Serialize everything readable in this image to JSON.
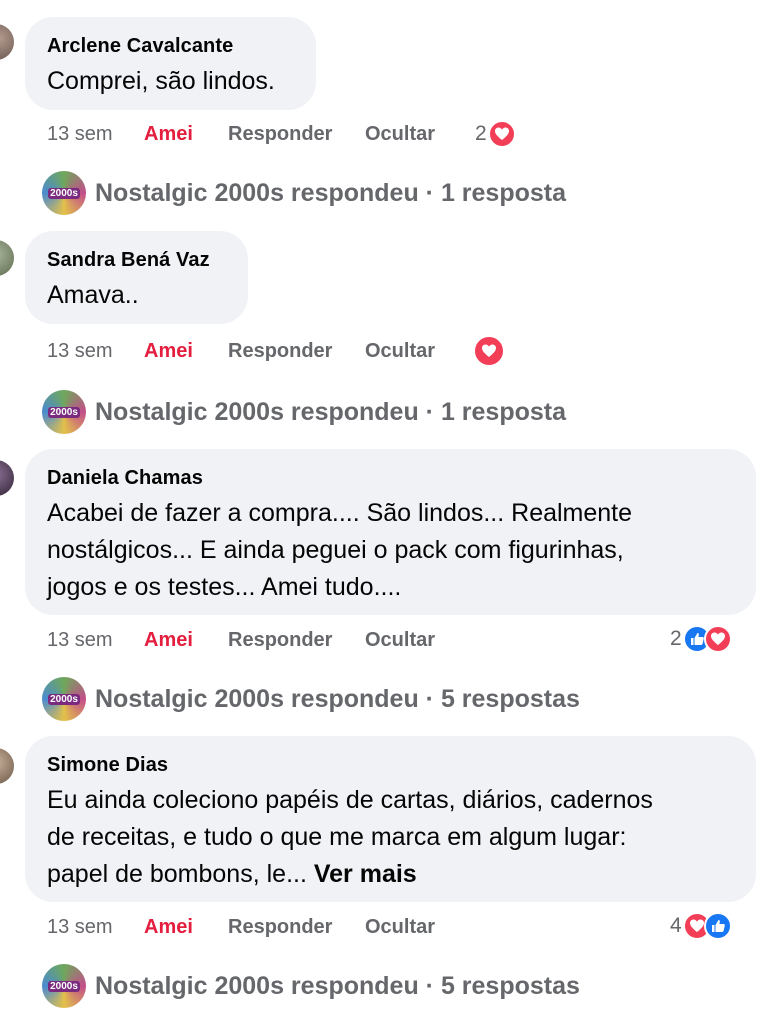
{
  "comments": [
    {
      "author": "Arclene Cavalcante",
      "text": "Comprei, são lindos.",
      "time": "13 sem",
      "reaction_label": "Amei",
      "reply_label": "Responder",
      "hide_label": "Ocultar",
      "reaction_count": "2",
      "reaction_icons": [
        "heart-icon"
      ],
      "page_reply": "Nostalgic 2000s respondeu · 1 resposta"
    },
    {
      "author": "Sandra Bená Vaz",
      "text": "Amava..",
      "time": "13 sem",
      "reaction_label": "Amei",
      "reply_label": "Responder",
      "hide_label": "Ocultar",
      "reaction_count": "",
      "reaction_icons": [
        "heart-icon"
      ],
      "page_reply": "Nostalgic 2000s respondeu · 1 resposta"
    },
    {
      "author": "Daniela Chamas",
      "text_lines": [
        "Acabei de fazer a compra.... São lindos... Realmente",
        "nostálgicos... E ainda peguei o pack com figurinhas,",
        "jogos e os testes... Amei tudo...."
      ],
      "time": "13 sem",
      "reaction_label": "Amei",
      "reply_label": "Responder",
      "hide_label": "Ocultar",
      "reaction_count": "2",
      "reaction_icons": [
        "like-icon",
        "heart-icon"
      ],
      "page_reply": "Nostalgic 2000s respondeu · 5 respostas"
    },
    {
      "author": "Simone Dias",
      "text_lines": [
        "Eu ainda coleciono papéis de cartas, diários, cadernos",
        "de receitas, e tudo o que me marca em algum lugar:",
        "papel de bombons, le..."
      ],
      "see_more": "Ver mais",
      "time": "13 sem",
      "reaction_label": "Amei",
      "reply_label": "Responder",
      "hide_label": "Ocultar",
      "reaction_count": "4",
      "reaction_icons": [
        "heart-icon",
        "like-icon"
      ],
      "page_reply": "Nostalgic 2000s respondeu · 5 respostas"
    }
  ],
  "page_avatar_text": "2000s"
}
